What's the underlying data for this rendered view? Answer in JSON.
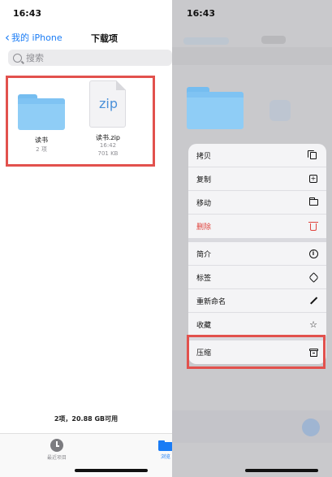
{
  "left": {
    "status_time": "16:43",
    "back_label": "我的 iPhone",
    "title": "下载项",
    "search_placeholder": "搜索",
    "folder": {
      "name": "读书",
      "count": "2 项"
    },
    "zip": {
      "icon_text": "zip",
      "name": "读书.zip",
      "time": "16:42",
      "size": "701 KB"
    },
    "storage": "2项，20.88 GB可用",
    "tabs": [
      {
        "label": "最近项目",
        "icon": "clock-icon"
      },
      {
        "label": "浏览",
        "icon": "folder-icon"
      }
    ]
  },
  "right": {
    "status_time": "16:43",
    "menu": [
      {
        "label": "拷贝",
        "icon": "copy-icon"
      },
      {
        "label": "复制",
        "icon": "duplicate-icon"
      },
      {
        "label": "移动",
        "icon": "folder-icon"
      },
      {
        "label": "删除",
        "icon": "trash-icon",
        "color": "#e0443e"
      },
      {
        "label": "简介",
        "icon": "info-icon"
      },
      {
        "label": "标签",
        "icon": "tag-icon"
      },
      {
        "label": "重新命名",
        "icon": "pencil-icon"
      },
      {
        "label": "收藏",
        "icon": "star-icon"
      },
      {
        "label": "压缩",
        "icon": "archive-icon"
      }
    ]
  },
  "colors": {
    "accent": "#1a7cf5",
    "highlight": "#e2514d",
    "destructive": "#e0443e",
    "folder": "#8fcdf6"
  }
}
